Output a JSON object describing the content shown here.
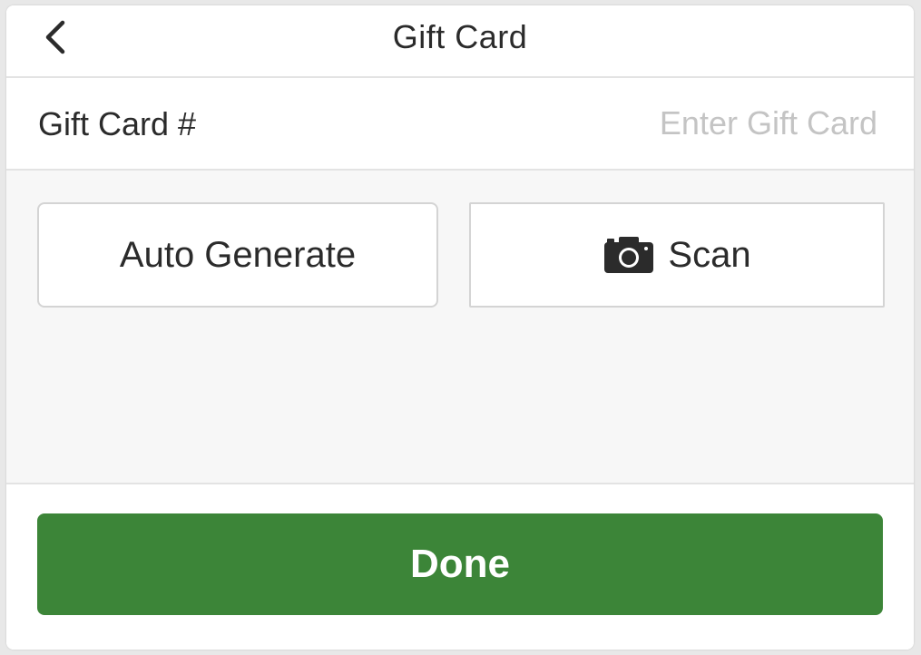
{
  "header": {
    "title": "Gift Card",
    "back_icon": "chevron-left-icon"
  },
  "gift_card_field": {
    "label": "Gift Card #",
    "value": "",
    "placeholder": "Enter Gift Card"
  },
  "options": {
    "auto_generate_label": "Auto Generate",
    "scan_label": "Scan",
    "scan_icon": "camera-icon"
  },
  "footer": {
    "done_label": "Done"
  },
  "colors": {
    "accent_green": "#3c8538",
    "text_dark": "#2b2b2b",
    "placeholder_gray": "#c4c4c4",
    "panel_bg": "#f7f7f7"
  }
}
